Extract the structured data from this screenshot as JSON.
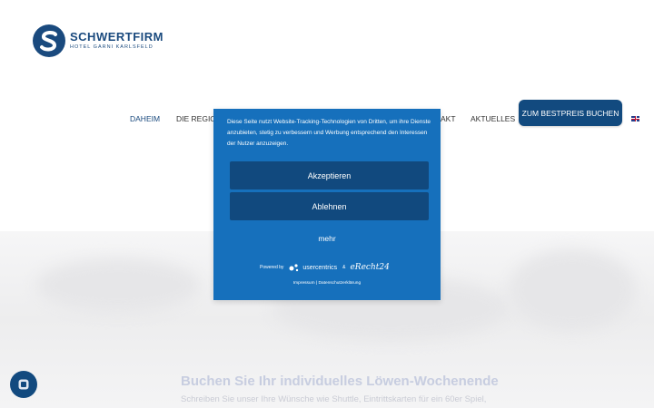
{
  "logo": {
    "name": "SCHWERTFIRM",
    "subtitle": "HOTEL GARNI KARLSFELD",
    "icon": "s-logo-icon"
  },
  "nav": {
    "items": [
      {
        "label": "DAHEIM",
        "active": true
      },
      {
        "label": "DIE REGION"
      },
      {
        "label": "AKT"
      },
      {
        "label": "AKTUELLES"
      }
    ],
    "book_button": "ZUM BESTPREIS BUCHEN",
    "language_icon": "uk-flag-icon"
  },
  "hero": {
    "title": "Buchen Sie Ihr individuelles Löwen-Wochenende",
    "subtitle": "Schreiben Sie unser Ihre Wünsche wie Shuttle, Eintrittskarten für ein 60er Spiel,"
  },
  "consent": {
    "text": "Diese Seite nutzt Website-Tracking-Technologien von Dritten, um ihre Dienste anzubieten, stetig zu verbessern und Werbung entsprechend den Interessen der Nutzer anzuzeigen.",
    "accept": "Akzeptieren",
    "decline": "Ablehnen",
    "more": "mehr",
    "powered_by": "Powered by",
    "usercentrics": "usercentrics",
    "amp": "&",
    "erecht": "eRecht24",
    "links": "Impressum | Datenschutzerklärung"
  },
  "chat": {
    "icon": "chat-icon"
  },
  "colors": {
    "brand": "#1a4a7e",
    "modal": "#1670bc",
    "button": "#11497e"
  }
}
